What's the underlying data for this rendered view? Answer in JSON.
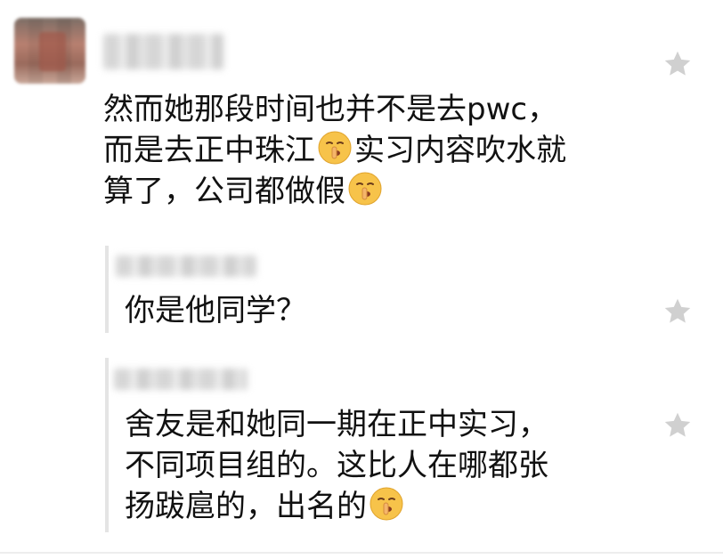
{
  "main_comment": {
    "line1": "然而她那段时间也并不是去pwc，",
    "line2_pre": "而是去正中珠江",
    "line2_post": "实习内容吹水就",
    "line3": "算了，公司都做假"
  },
  "reply1": {
    "text": "你是他同学？"
  },
  "reply2": {
    "line1": "舍友是和她同一期在正中实习，",
    "line2": "不同项目组的。这比人在哪都张",
    "line3": "扬跋扈的，出名的"
  },
  "icons": {
    "emoji": "shushing-face-emoji",
    "star": "star-icon"
  },
  "colors": {
    "star": "#d0d0d0",
    "emoji": "#f7c34a",
    "reply_bar": "#e4e4e4"
  }
}
